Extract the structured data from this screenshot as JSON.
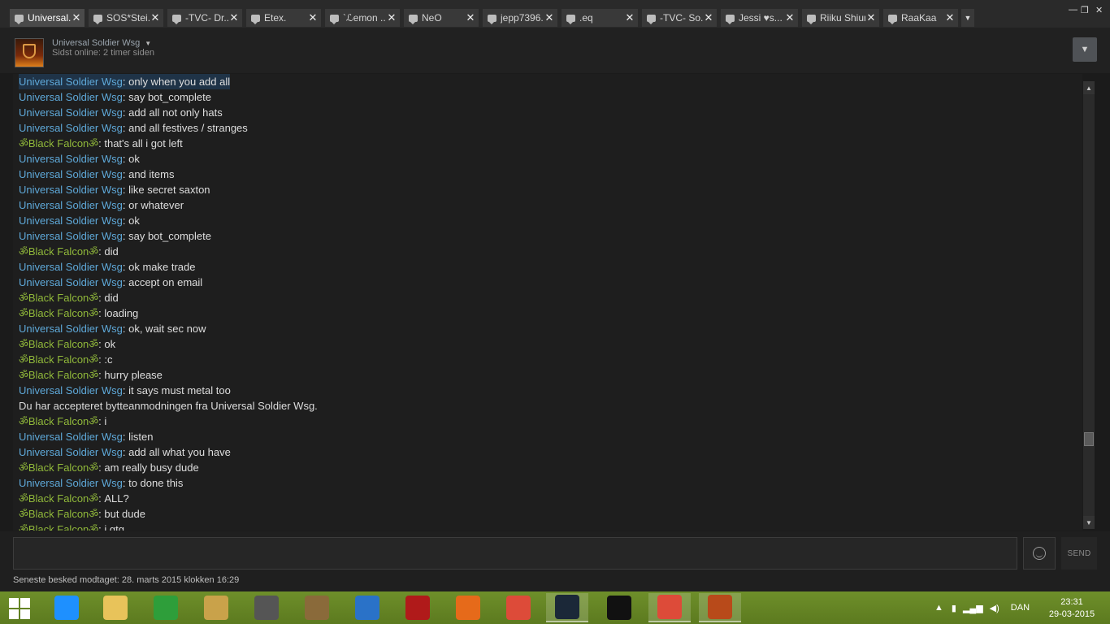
{
  "tabs": [
    {
      "label": "Universal...",
      "active": true
    },
    {
      "label": "SOS*Stei..."
    },
    {
      "label": "-TVC- Dr..."
    },
    {
      "label": "Etex."
    },
    {
      "label": "`ℒemon ..."
    },
    {
      "label": "NeO"
    },
    {
      "label": "jepp7396..."
    },
    {
      "label": ".eq"
    },
    {
      "label": "-TVC- So..."
    },
    {
      "label": "Jessi ♥s..."
    },
    {
      "label": "Riiku Shiun"
    },
    {
      "label": "RaaKaa"
    }
  ],
  "header": {
    "name": "Universal Soldier Wsg",
    "status": "Sidst online: 2 timer siden"
  },
  "messages": [
    {
      "sender": "Universal Soldier Wsg",
      "type": "us",
      "text": ": only when you add all",
      "selected": true
    },
    {
      "sender": "Universal Soldier Wsg",
      "type": "us",
      "text": ": say bot_complete"
    },
    {
      "sender": "Universal Soldier Wsg",
      "type": "us",
      "text": ": add all not only hats"
    },
    {
      "sender": "Universal Soldier Wsg",
      "type": "us",
      "text": ": and all festives / stranges"
    },
    {
      "sender": "ॐBlack Falconॐ",
      "type": "bf",
      "text": ": that's all i got left"
    },
    {
      "sender": "Universal Soldier Wsg",
      "type": "us",
      "text": ": ok"
    },
    {
      "sender": "Universal Soldier Wsg",
      "type": "us",
      "text": ": and items"
    },
    {
      "sender": "Universal Soldier Wsg",
      "type": "us",
      "text": ": like secret saxton"
    },
    {
      "sender": "Universal Soldier Wsg",
      "type": "us",
      "text": ": or whatever"
    },
    {
      "sender": "Universal Soldier Wsg",
      "type": "us",
      "text": ": ok"
    },
    {
      "sender": "Universal Soldier Wsg",
      "type": "us",
      "text": ": say bot_complete"
    },
    {
      "sender": "ॐBlack Falconॐ",
      "type": "bf",
      "text": ": did"
    },
    {
      "sender": "Universal Soldier Wsg",
      "type": "us",
      "text": ": ok make trade"
    },
    {
      "sender": "Universal Soldier Wsg",
      "type": "us",
      "text": ": accept on email"
    },
    {
      "sender": "ॐBlack Falconॐ",
      "type": "bf",
      "text": ": did"
    },
    {
      "sender": "ॐBlack Falconॐ",
      "type": "bf",
      "text": ": loading"
    },
    {
      "sender": "Universal Soldier Wsg",
      "type": "us",
      "text": ": ok, wait sec now"
    },
    {
      "sender": "ॐBlack Falconॐ",
      "type": "bf",
      "text": ": ok"
    },
    {
      "sender": "ॐBlack Falconॐ",
      "type": "bf",
      "text": ": :c"
    },
    {
      "sender": "ॐBlack Falconॐ",
      "type": "bf",
      "text": ": hurry please"
    },
    {
      "sender": "Universal Soldier Wsg",
      "type": "us",
      "text": ": it says must metal too"
    },
    {
      "sender": "",
      "type": "sys",
      "text": "Du har accepteret bytteanmodningen fra Universal Soldier Wsg."
    },
    {
      "sender": "ॐBlack Falconॐ",
      "type": "bf",
      "text": ": i"
    },
    {
      "sender": "Universal Soldier Wsg",
      "type": "us",
      "text": ": listen"
    },
    {
      "sender": "Universal Soldier Wsg",
      "type": "us",
      "text": ": add all what you have"
    },
    {
      "sender": "ॐBlack Falconॐ",
      "type": "bf",
      "text": ": am really busy dude"
    },
    {
      "sender": "Universal Soldier Wsg",
      "type": "us",
      "text": ": to done this"
    },
    {
      "sender": "ॐBlack Falconॐ",
      "type": "bf",
      "text": ": ALL?"
    },
    {
      "sender": "ॐBlack Falconॐ",
      "type": "bf",
      "text": ": but dude"
    },
    {
      "sender": "ॐBlack Falconॐ",
      "type": "bf",
      "text": ": i gtg"
    }
  ],
  "input": {
    "value": "",
    "send_label": "SEND"
  },
  "last_message": "Seneste besked modtaget: 28. marts 2015 klokken 16:29",
  "taskbar": {
    "apps": [
      {
        "icon": "internet-explorer-icon",
        "color": "#1e90ff"
      },
      {
        "icon": "file-explorer-icon",
        "color": "#e8c35a"
      },
      {
        "icon": "store-icon",
        "color": "#2e9e3a"
      },
      {
        "icon": "app-icon",
        "color": "#c9a24a"
      },
      {
        "icon": "speaker-app-icon",
        "color": "#555555"
      },
      {
        "icon": "document-app-icon",
        "color": "#8a6a3a"
      },
      {
        "icon": "settings-app-icon",
        "color": "#2a72c8"
      },
      {
        "icon": "power-icon",
        "color": "#b01a1a"
      },
      {
        "icon": "firefox-icon",
        "color": "#e66a1a"
      },
      {
        "icon": "chrome-icon",
        "color": "#dd4b39"
      },
      {
        "icon": "steam-icon",
        "color": "#1b2838",
        "running": true
      },
      {
        "icon": "command-prompt-icon",
        "color": "#111111"
      },
      {
        "icon": "chrome-icon",
        "color": "#dd4b39",
        "running": true
      },
      {
        "icon": "tf2-icon",
        "color": "#b84a1a",
        "running": true
      }
    ],
    "language": "DAN",
    "time": "23:31",
    "date": "29-03-2015"
  }
}
